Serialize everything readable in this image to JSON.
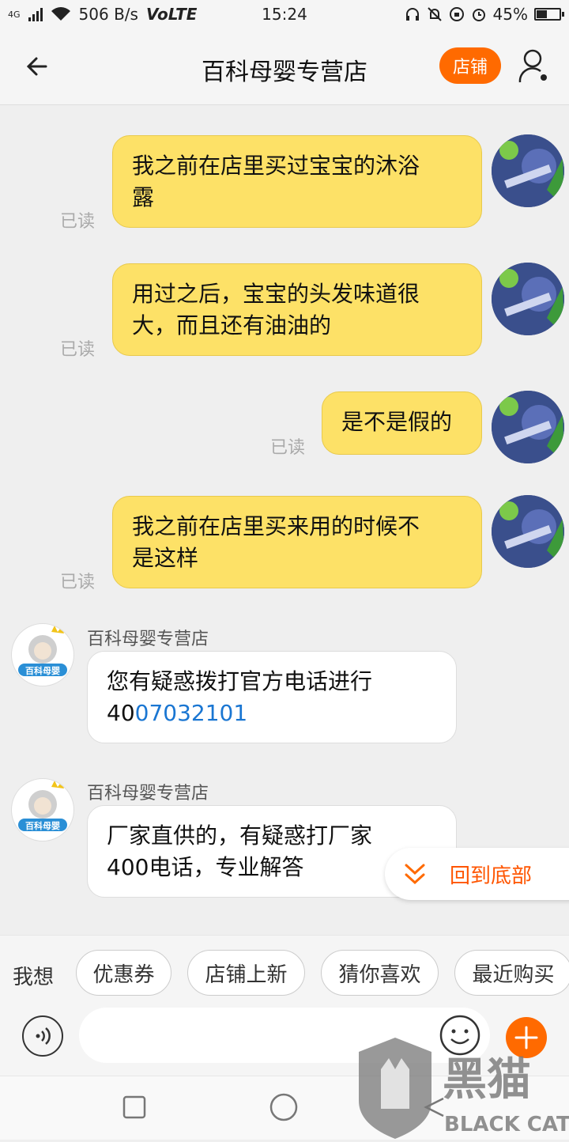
{
  "status_bar": {
    "network": "4G",
    "speed": "506 B/s",
    "volte": "VoLTE",
    "time": "15:24",
    "battery": "45%",
    "battery_level": 0.45
  },
  "header": {
    "title": "百科母婴专营店",
    "shop_button": "店铺"
  },
  "messages": {
    "m1": {
      "line1": "我之前在店里买过宝宝的沐浴",
      "line2": "露",
      "status": "已读"
    },
    "m2": {
      "line1": "用过之后，宝宝的头发味道很",
      "line2": "大，而且还有油油的",
      "status": "已读"
    },
    "m3": {
      "line1": "是不是假的",
      "status": "已读"
    },
    "m4": {
      "line1": "我之前在店里买来用的时候不",
      "line2": "是这样",
      "status": "已读"
    },
    "s1": {
      "sender": "百科母婴专营店",
      "line1": "您有疑惑拨打官方电话进行",
      "prefix": "40",
      "phone_link": "07032101"
    },
    "s2": {
      "sender": "百科母婴专营店",
      "line1": "厂家直供的，有疑惑打厂家",
      "line2": "400电话，专业解答"
    }
  },
  "back_to_bottom": "回到底部",
  "suggestions": {
    "lead": "我想",
    "chips": [
      "优惠券",
      "店铺上新",
      "猜你喜欢",
      "最近购买"
    ]
  },
  "input": {
    "placeholder": ""
  },
  "avatar_text": "百科母婴",
  "watermark": {
    "cn": "黑猫",
    "en": "BLACK CAT"
  },
  "colors": {
    "accent": "#ff6a00",
    "bubble_me": "#fde167",
    "link": "#1a76d2"
  }
}
